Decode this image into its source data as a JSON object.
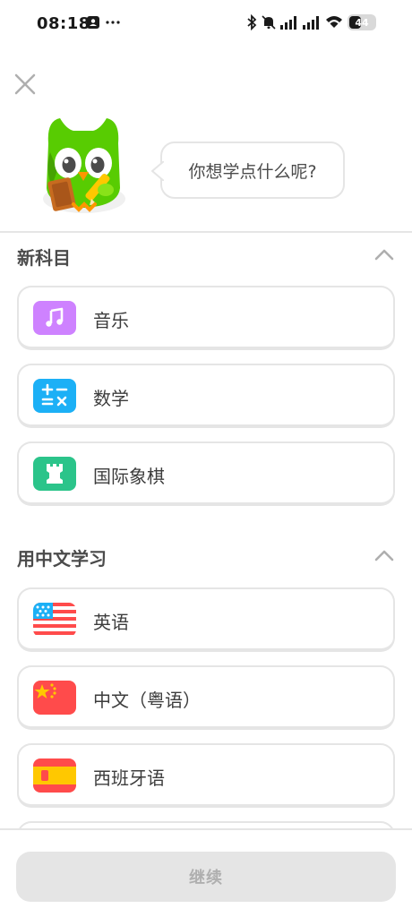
{
  "status_bar": {
    "time": "08:18",
    "battery_level": "44"
  },
  "mascot_prompt": "你想学点什么呢?",
  "sections": {
    "new_subjects": {
      "title": "新科目",
      "items": [
        {
          "label": "音乐",
          "icon": "music-note-icon",
          "color": "#ce82ff"
        },
        {
          "label": "数学",
          "icon": "math-operators-icon",
          "color": "#1cb0f6"
        },
        {
          "label": "国际象棋",
          "icon": "chess-rook-icon",
          "color": "#2bc48a"
        }
      ]
    },
    "learn_in_chinese": {
      "title": "用中文学习",
      "items": [
        {
          "label": "英语",
          "icon": "us-flag-icon"
        },
        {
          "label": "中文（粤语）",
          "icon": "china-flag-icon"
        },
        {
          "label": "西班牙语",
          "icon": "spain-flag-icon"
        }
      ]
    }
  },
  "footer": {
    "continue_label": "继续"
  },
  "colors": {
    "border": "#e5e5e5",
    "text": "#3c3c3c",
    "disabled_button": "#e5e5e5",
    "disabled_text": "#afafaf"
  }
}
